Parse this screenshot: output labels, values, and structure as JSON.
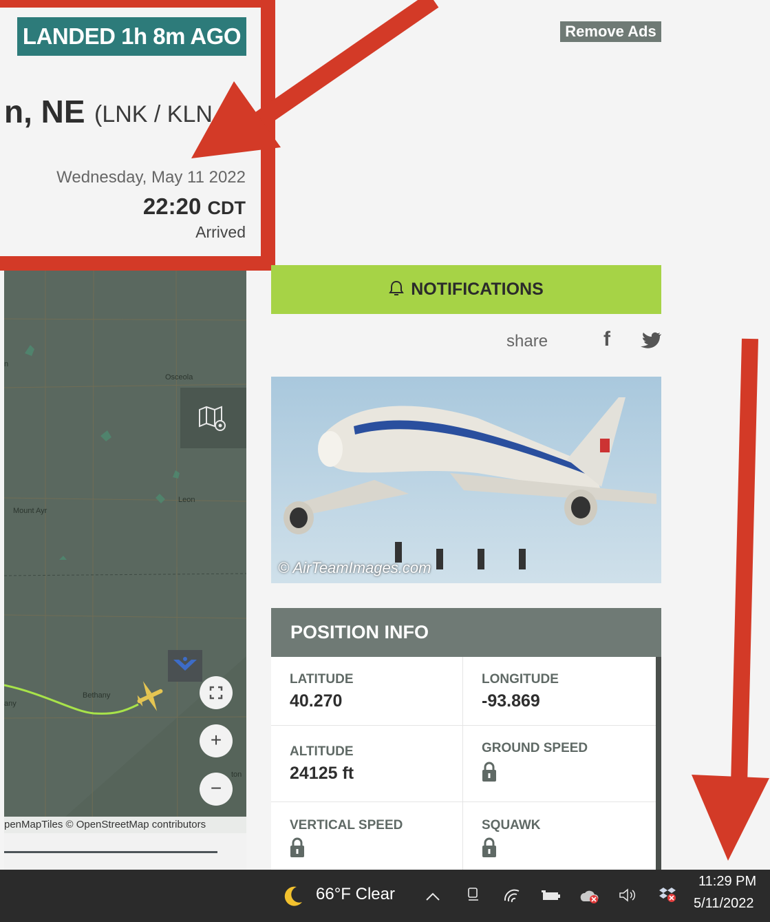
{
  "flight": {
    "landed_badge": "LANDED 1h 8m AGO",
    "dest_city": "n, NE",
    "dest_codes": "(LNK / KLN",
    "arrival_date": "Wednesday, May 11 2022",
    "arrival_time": "22:20",
    "arrival_tz": "CDT",
    "arrival_status": "Arrived"
  },
  "header": {
    "remove_ads": "Remove Ads"
  },
  "notifications": {
    "label": "NOTIFICATIONS",
    "icon": "bell-icon"
  },
  "share": {
    "label": "share",
    "facebook": "f",
    "icons": [
      "facebook-icon",
      "twitter-icon"
    ]
  },
  "photo": {
    "credit": "© AirTeamImages.com"
  },
  "position_info": {
    "title": "POSITION INFO",
    "latitude_label": "LATITUDE",
    "latitude": "40.270",
    "longitude_label": "LONGITUDE",
    "longitude": "-93.869",
    "altitude_label": "ALTITUDE",
    "altitude": "24125 ft",
    "ground_speed_label": "GROUND SPEED",
    "vertical_speed_label": "VERTICAL SPEED",
    "squawk_label": "SQUAWK",
    "locked_icon": "lock-icon"
  },
  "map": {
    "places": [
      "Osceola",
      "Mount Ayr",
      "Leon",
      "Bethany",
      "any",
      "ton",
      "n"
    ],
    "attribution": "penMapTiles © OpenStreetMap contributors",
    "zoom_in": "+",
    "zoom_out": "−"
  },
  "taskbar": {
    "weather": "66°F  Clear",
    "time": "11:29 PM",
    "date": "5/11/2022",
    "tray_icons": [
      "chevron-up-icon",
      "meet-now-icon",
      "wifi-icon",
      "battery-icon",
      "onedrive-icon",
      "speaker-icon",
      "dropbox-icon"
    ]
  },
  "colors": {
    "badge": "#2d7b7a",
    "notifications": "#a6d346",
    "panel_header": "#6f7a75",
    "annotation": "#d33a27",
    "route": "#a8e34a"
  }
}
